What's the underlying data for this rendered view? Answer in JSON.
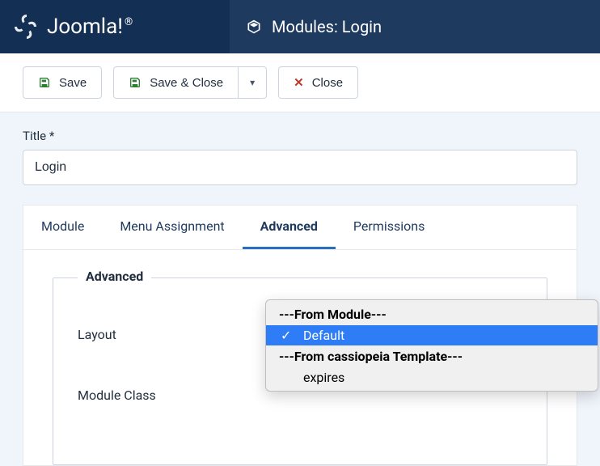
{
  "brand": {
    "name": "Joomla!",
    "registered": "®"
  },
  "page": {
    "icon": "cube",
    "title": "Modules: Login"
  },
  "toolbar": {
    "save": "Save",
    "save_close": "Save & Close",
    "close": "Close"
  },
  "title_field": {
    "label": "Title *",
    "value": "Login"
  },
  "tabs": {
    "module": "Module",
    "menu_assignment": "Menu Assignment",
    "advanced": "Advanced",
    "permissions": "Permissions"
  },
  "fieldset": {
    "legend": "Advanced",
    "layout_label": "Layout",
    "module_class_label": "Module Class"
  },
  "dropdown": {
    "group1": "---From Module---",
    "option_default": "Default",
    "group2": "---From cassiopeia Template---",
    "option_expires": "expires"
  }
}
